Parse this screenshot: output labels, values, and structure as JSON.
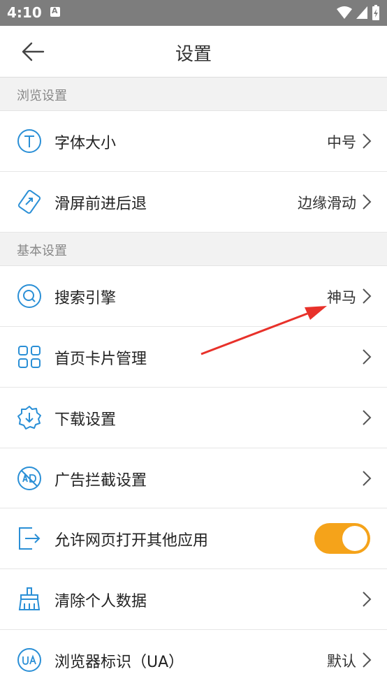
{
  "status": {
    "time": "4:10"
  },
  "header": {
    "title": "设置"
  },
  "sections": {
    "browse": "浏览设置",
    "basic": "基本设置"
  },
  "rows": {
    "font": {
      "label": "字体大小",
      "value": "中号"
    },
    "swipe": {
      "label": "滑屏前进后退",
      "value": "边缘滑动"
    },
    "search": {
      "label": "搜索引擎",
      "value": "神马"
    },
    "cards": {
      "label": "首页卡片管理"
    },
    "download": {
      "label": "下载设置"
    },
    "adblock": {
      "label": "广告拦截设置"
    },
    "openapps": {
      "label": "允许网页打开其他应用",
      "toggle_on": true
    },
    "cleardata": {
      "label": "清除个人数据"
    },
    "ua": {
      "label": "浏览器标识（UA）",
      "value": "默认"
    }
  },
  "colors": {
    "accent": "#2a8fd6",
    "toggle": "#f5a31a",
    "annotation": "#e8312a"
  }
}
